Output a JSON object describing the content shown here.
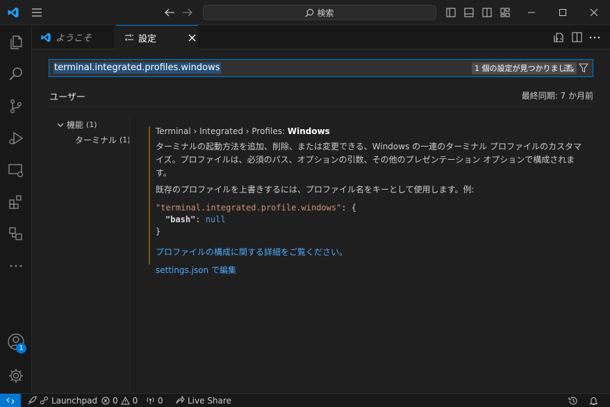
{
  "titlebar": {
    "search_placeholder": "検索"
  },
  "tabs": [
    {
      "label": "ようこそ",
      "active": false
    },
    {
      "label": "設定",
      "active": true
    }
  ],
  "settings": {
    "search_value": "terminal.integrated.profiles.windows",
    "result_count": "1 個の設定が見つかりました",
    "scope_tab": "ユーザー",
    "last_sync": "最終同期: 7 か月前",
    "toc": [
      {
        "label": "機能",
        "count": "(1)"
      },
      {
        "label": "ターミナル",
        "count": "(1)"
      }
    ],
    "item": {
      "breadcrumb_prefix": "Terminal › Integrated › Profiles: ",
      "title": "Windows",
      "description_1": "ターミナルの起動方法を追加、削除、または変更できる、Windows の一連のターミナル プロファイルのカスタマイズ。プロファイルは、必須のパス、オプションの引数、その他のプレゼンテーション オプションで構成されます。",
      "description_2": "既存のプロファイルを上書きするには、プロファイル名をキーとして使用します。例:",
      "code_key": "\"terminal.integrated.profile.windows\"",
      "code_colon_brace": ": {",
      "code_inner_key": "\"bash\"",
      "code_inner_colon": ": ",
      "code_inner_value": "null",
      "code_close": "}",
      "link_more": "プロファイルの構成に関する詳細をご覧ください。",
      "link_edit": "settings.json で編集"
    }
  },
  "activity": {
    "accounts_badge": "1"
  },
  "statusbar": {
    "launchpad": "Launchpad",
    "errors": "0",
    "warnings": "0",
    "ports": "0",
    "live_share": "Live Share"
  },
  "colors": {
    "accent": "#0078d4",
    "link": "#4daafc",
    "string": "#ce9178",
    "keyword": "#569cd6"
  }
}
